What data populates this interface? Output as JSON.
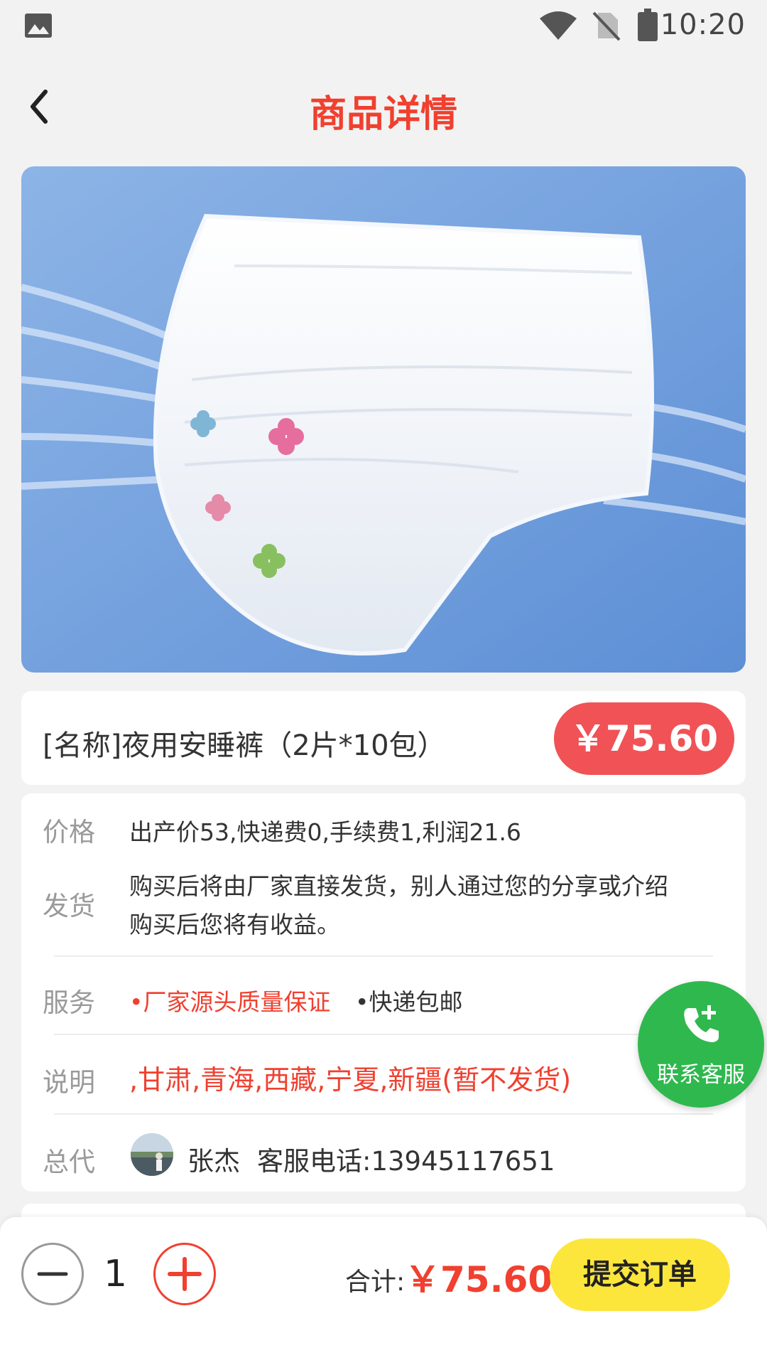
{
  "status_bar": {
    "time": "10:20",
    "icons": [
      "image-icon",
      "wifi-icon",
      "no-sim-icon",
      "battery-icon"
    ]
  },
  "header": {
    "title": "商品详情",
    "back_icon": "chevron-left-icon"
  },
  "product": {
    "name": "[名称]夜用安睡裤（2片*10包）",
    "price": "￥75.60"
  },
  "details": {
    "price_label": "价格",
    "price_value": "出产价53,快递费0,手续费1,利润21.6",
    "ship_label": "发货",
    "ship_line1": "购买后将由厂家直接发货，别人通过您的分享或介绍",
    "ship_line2": "购买后您将有收益。",
    "service_label": "服务",
    "service_1": "•厂家源头质量保证",
    "service_2": "•快递包邮",
    "note_label": "说明",
    "note_value": ",甘肃,青海,西藏,宁夏,新疆(暂不发货)",
    "agent_label": "总代",
    "agent_name": "张杰",
    "agent_phone": "客服电话:13945117651"
  },
  "contact": {
    "label": "联系客服",
    "icon": "phone-add-icon"
  },
  "footer": {
    "quantity": "1",
    "total_label": "合计:",
    "total_value": "￥75.60",
    "submit_label": "提交订单"
  },
  "colors": {
    "accent_red": "#f0402f",
    "price_badge": "#f05256",
    "contact_green": "#2fb84e",
    "submit_yellow": "#fce63c"
  }
}
